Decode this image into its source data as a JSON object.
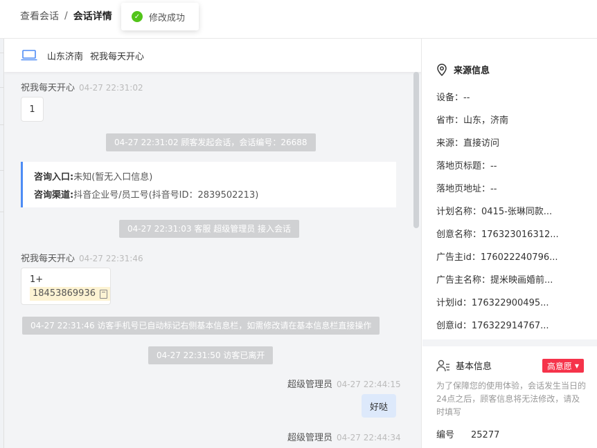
{
  "breadcrumb": {
    "parent": "查看会话",
    "separator": "/",
    "current": "会话详情"
  },
  "toast": {
    "message": "修改成功",
    "color": "#52c41a"
  },
  "chat_header": {
    "location": "山东济南",
    "visitor_name": "祝我每天开心"
  },
  "messages": {
    "m1": {
      "sender": "祝我每天开心",
      "time": "04-27 22:31:02",
      "text": "1"
    },
    "sys1": "04-27 22:31:02 顾客发起会话，会话编号：26688",
    "info_card": {
      "entry_label": "咨询入口:",
      "entry_value": "未知(暂无入口信息)",
      "channel_label": "咨询渠道:",
      "channel_value": "抖音企业号/员工号(抖音号ID：2839502213)"
    },
    "sys2": "04-27 22:31:03 客服 超级管理员 接入会话",
    "m2": {
      "sender": "祝我每天开心",
      "time": "04-27 22:31:46",
      "line1": "1+",
      "phone": "18453869936"
    },
    "sys3": "04-27 22:31:46 访客手机号已自动标记右侧基本信息栏，如需修改请在基本信息栏直接操作",
    "sys4": "04-27 22:31:50 访客已离开",
    "m3": {
      "sender": "超级管理员",
      "time": "04-27 22:44:15",
      "text": "好哒"
    },
    "m4": {
      "sender": "超级管理员",
      "time": "04-27 22:44:34"
    }
  },
  "source_info": {
    "title": "来源信息",
    "fields": [
      "设备：--",
      "省市：山东，济南",
      "来源：直接访问",
      "落地页标题：--",
      "落地页地址：--",
      "计划名称：0415-张琳同款...",
      "创意名称：176323016312...",
      "广告主id：176022240796...",
      "广告主名称：提米映画婚前...",
      "计划id：176322900495...",
      "创意id：176322914767..."
    ]
  },
  "basic_info": {
    "title": "基本信息",
    "badge": "高意愿",
    "badge_color": "#f5334a",
    "notice": "为了保障您的使用体验，会话发生当日的24点之后，顾客信息将无法修改，请及时填写",
    "id_label": "编号",
    "id_value": "25277"
  },
  "icons": {
    "toast": "check-circle-icon",
    "chat_header": "laptop-icon",
    "source": "location-pin-icon",
    "basic": "user-list-icon",
    "copy": "copy-icon"
  },
  "colors": {
    "accent_blue": "#4d8cf5",
    "reply_bubble": "#dde9fb",
    "system_msg": "#d0d1d3",
    "phone_highlight": "#fdf3d3"
  }
}
